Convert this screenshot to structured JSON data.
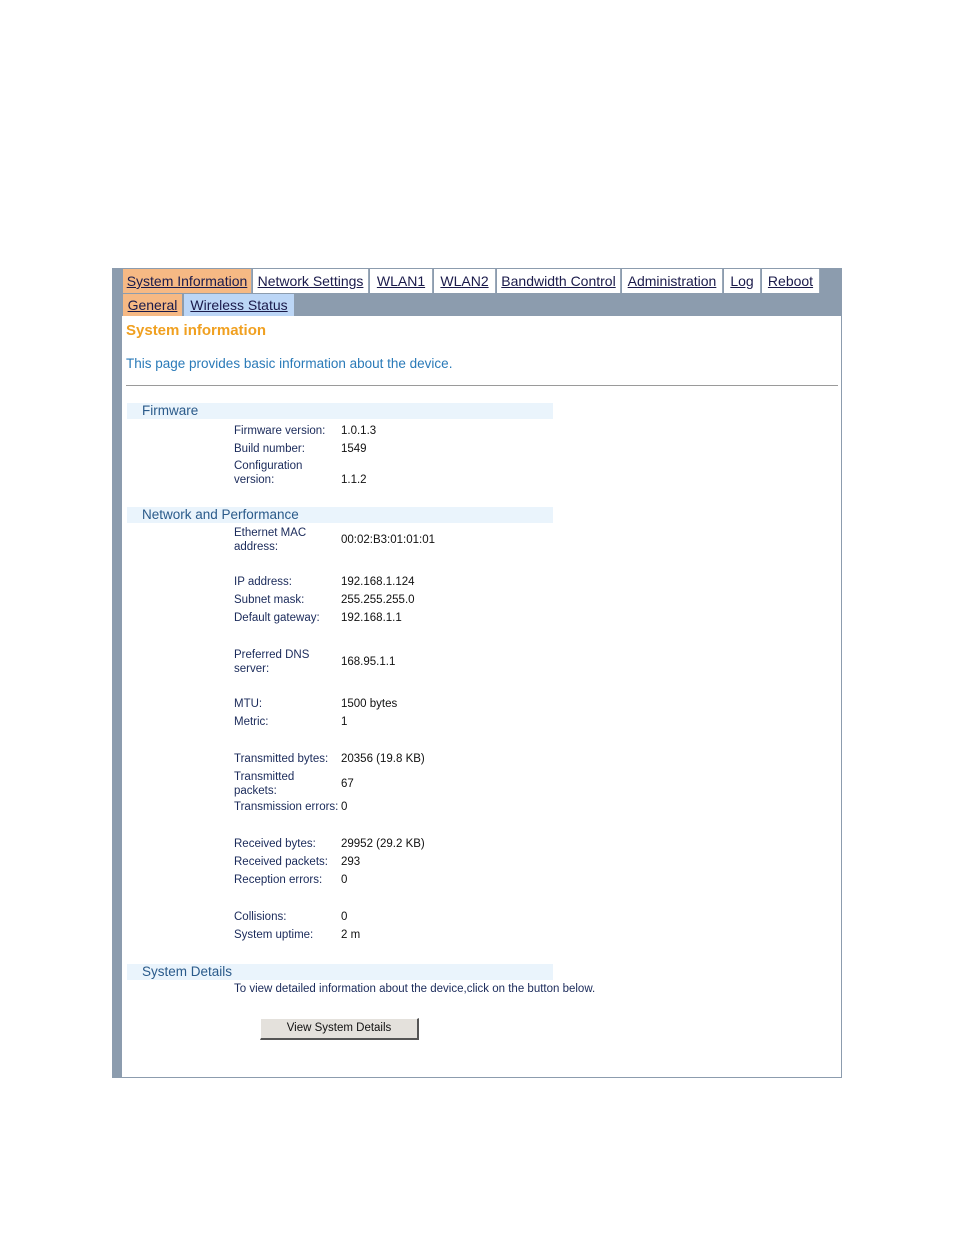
{
  "tabs": [
    {
      "label": "System Information"
    },
    {
      "label": "Network Settings"
    },
    {
      "label": "WLAN1"
    },
    {
      "label": "WLAN2"
    },
    {
      "label": "Bandwidth Control"
    },
    {
      "label": "Administration"
    },
    {
      "label": "Log"
    },
    {
      "label": "Reboot"
    }
  ],
  "subtabs": [
    {
      "label": "General"
    },
    {
      "label": "Wireless Status"
    }
  ],
  "page": {
    "title": "System information",
    "description": "This page provides basic information about the device."
  },
  "sections": {
    "firmware": {
      "title": "Firmware",
      "rows": [
        {
          "label": "Firmware version:",
          "value": "1.0.1.3"
        },
        {
          "label": "Build number:",
          "value": "1549"
        },
        {
          "label": "Configuration version:",
          "value": "1.1.2"
        }
      ]
    },
    "network": {
      "title": "Network and Performance",
      "rows": [
        {
          "label": "Ethernet MAC address:",
          "value": "00:02:B3:01:01:01"
        },
        {
          "label": "IP address:",
          "value": "192.168.1.124"
        },
        {
          "label": "Subnet mask:",
          "value": "255.255.255.0"
        },
        {
          "label": "Default gateway:",
          "value": "192.168.1.1"
        },
        {
          "label": "Preferred DNS server:",
          "value": "168.95.1.1"
        },
        {
          "label": "MTU:",
          "value": "1500 bytes"
        },
        {
          "label": "Metric:",
          "value": "1"
        },
        {
          "label": "Transmitted bytes:",
          "value": "20356 (19.8 KB)"
        },
        {
          "label": "Transmitted packets:",
          "value": "67"
        },
        {
          "label": "Transmission errors:",
          "value": "0"
        },
        {
          "label": "Received bytes:",
          "value": "29952 (29.2 KB)"
        },
        {
          "label": "Received packets:",
          "value": "293"
        },
        {
          "label": "Reception errors:",
          "value": "0"
        },
        {
          "label": "Collisions:",
          "value": "0"
        },
        {
          "label": "System uptime:",
          "value": "2 m"
        }
      ]
    },
    "details": {
      "title": "System Details",
      "note": "To view detailed information about the device,click on the button below.",
      "button_label": "View System Details"
    }
  },
  "colors": {
    "frame": "#8c9cae",
    "active_tab": "#f6b984",
    "subtab_alt": "#bcd6f6",
    "title": "#f0a020",
    "description": "#2a7ab8",
    "section_bg": "#eaf4fc"
  }
}
